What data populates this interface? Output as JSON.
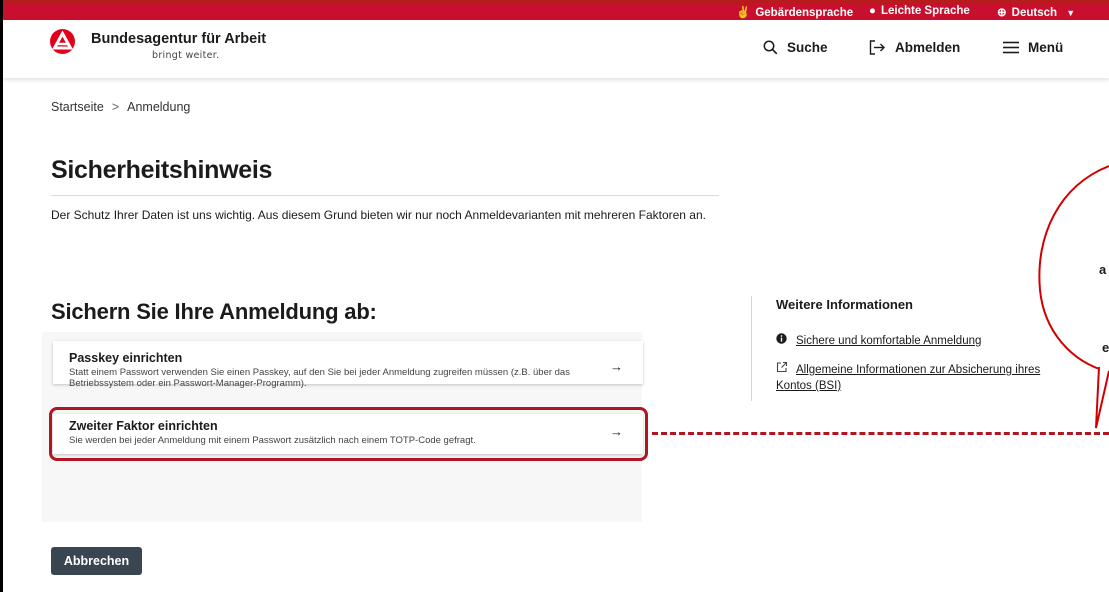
{
  "topbar": {
    "items": [
      {
        "icon": "sign-language-icon",
        "label": "Gebärdensprache"
      },
      {
        "icon": "easy-language-icon",
        "label": "Leichte Sprache"
      },
      {
        "icon": "globe-icon",
        "label": "Deutsch"
      }
    ]
  },
  "header": {
    "brand_name": "Bundesagentur für Arbeit",
    "brand_tagline": "bringt weiter.",
    "search_label": "Suche",
    "logout_label": "Abmelden",
    "menu_label": "Menü"
  },
  "breadcrumb": {
    "home": "Startseite",
    "separator": ">",
    "current": "Anmeldung"
  },
  "main": {
    "title": "Sicherheitshinweis",
    "intro": "Der Schutz Ihrer Daten ist uns wichtig. Aus diesem Grund bieten wir nur noch Anmeldevarianten mit mehreren Faktoren an.",
    "section_title": "Sichern Sie Ihre Anmeldung ab:",
    "options": [
      {
        "title": "Passkey einrichten",
        "description": "Statt einem Passwort verwenden Sie einen Passkey, auf den Sie bei jeder Anmeldung zugreifen müssen (z.B. über das Betriebssystem oder ein Passwort-Manager-Programm).",
        "arrow": "→"
      },
      {
        "title": "Zweiter Faktor einrichten",
        "description": "Sie werden bei jeder Anmeldung mit einem Passwort zusätzlich nach einem TOTP-Code gefragt.",
        "arrow": "→"
      }
    ],
    "cancel_label": "Abbrechen"
  },
  "aside": {
    "title": "Weitere Informationen",
    "links": [
      {
        "icon": "info-icon",
        "label": "Sichere und komfortable Anmeldung"
      },
      {
        "icon": "external-link-icon",
        "label": "Allgemeine Informationen zur Absicherung ihres Kontos (BSI)"
      }
    ]
  },
  "callout": {
    "fragments": [
      "a",
      "e"
    ]
  },
  "colors": {
    "brand_red": "#c8102e",
    "highlight": "#b01621",
    "button_dark": "#3a4552"
  }
}
